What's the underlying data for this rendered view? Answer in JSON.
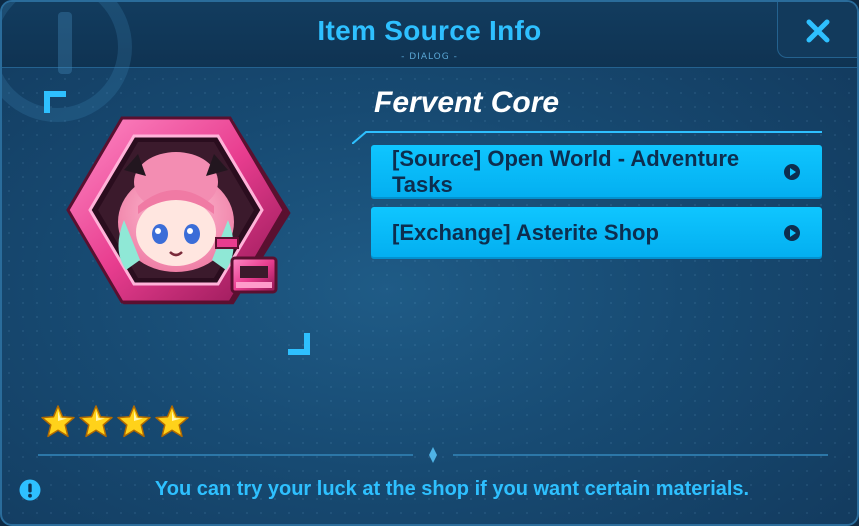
{
  "dialog": {
    "title": "Item Source Info",
    "subtitle": "- DIALOG -",
    "close_icon": "close-x-icon"
  },
  "item": {
    "name": "Fervent Core",
    "icon": "fervent-core-hexagon-chibi-icon",
    "rarity_stars": 4
  },
  "sources": [
    {
      "label": "[Source] Open World - Adventure Tasks",
      "icon": "play-circle-icon"
    },
    {
      "label": "[Exchange] Asterite Shop",
      "icon": "play-circle-icon"
    }
  ],
  "hint": {
    "icon": "info-exclamation-icon",
    "text": "You can try your luck at the shop if you want certain materials."
  },
  "colors": {
    "accent": "#2ec0ff",
    "button": "#03aef0",
    "button_text": "#0d2e4f",
    "background": "#174a72",
    "star": "#ffd21a",
    "item_frame": "#e83d8f"
  }
}
